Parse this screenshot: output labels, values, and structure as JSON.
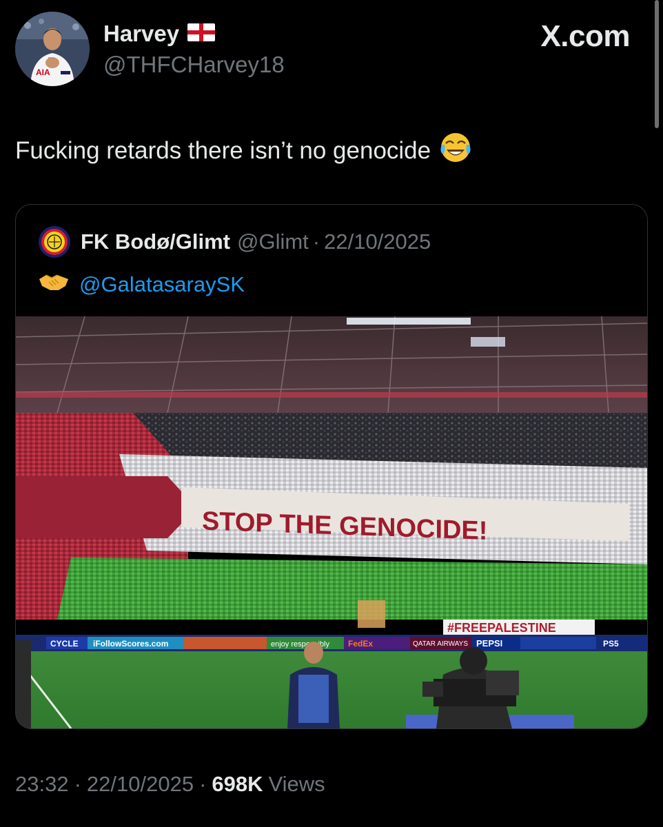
{
  "author": {
    "display_name": "Harvey",
    "flag_icon": "england-flag-icon",
    "handle": "@THFCHarvey18"
  },
  "site_label": "X.com",
  "tweet": {
    "text": "Fucking retards there isn’t no genocide",
    "emoji_icon": "face-with-tears-of-joy-icon"
  },
  "quoted_tweet": {
    "display_name": "FK Bodø/Glimt",
    "handle": "@Glimt",
    "date": "22/10/2025",
    "handshake_icon": "handshake-icon",
    "mention": "@GalatasaraySK",
    "photo": {
      "banner_text": "STOP THE GENOCIDE!",
      "sign_text": "#FREEPALESTINE",
      "ad_followscores": "iFollowScores.com",
      "ad_enjoy": "enjoy responsibly",
      "ad_qatar": "QATAR AIRWAYS",
      "ad_pepsi": "PEPSI",
      "ad_ps5": "PS5",
      "ad_cycle": "CYCLE",
      "ad_fedex": "FedEx"
    }
  },
  "meta": {
    "time": "23:32",
    "date": "22/10/2025",
    "views_count": "698K",
    "views_label": "Views"
  },
  "colors": {
    "background": "#000000",
    "text_primary": "#e7e9ea",
    "text_secondary": "#71767b",
    "link": "#1d9bf0",
    "border": "#2f3336"
  }
}
